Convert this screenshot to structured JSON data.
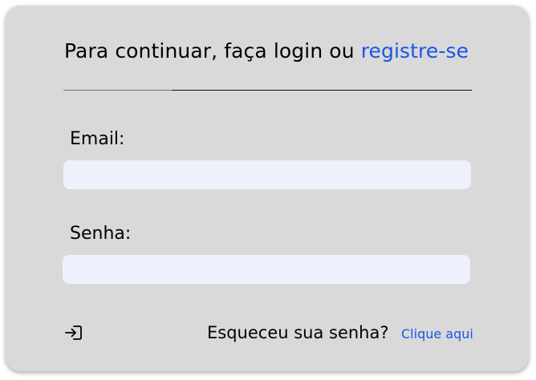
{
  "login_card": {
    "heading_prefix": "Para continuar, faça login ou ",
    "register_link": "registre-se",
    "email_label": "Email:",
    "email_value": "",
    "password_label": "Senha:",
    "password_value": "",
    "login_icon": "sign-in-arrow-icon",
    "forgot_text": "Esqueceu sua senha?",
    "forgot_link": "Clique aqui"
  },
  "colors": {
    "card_background": "#d9d9d9",
    "input_background": "#edf1fb",
    "link": "#1a56e8",
    "text": "#000000"
  }
}
